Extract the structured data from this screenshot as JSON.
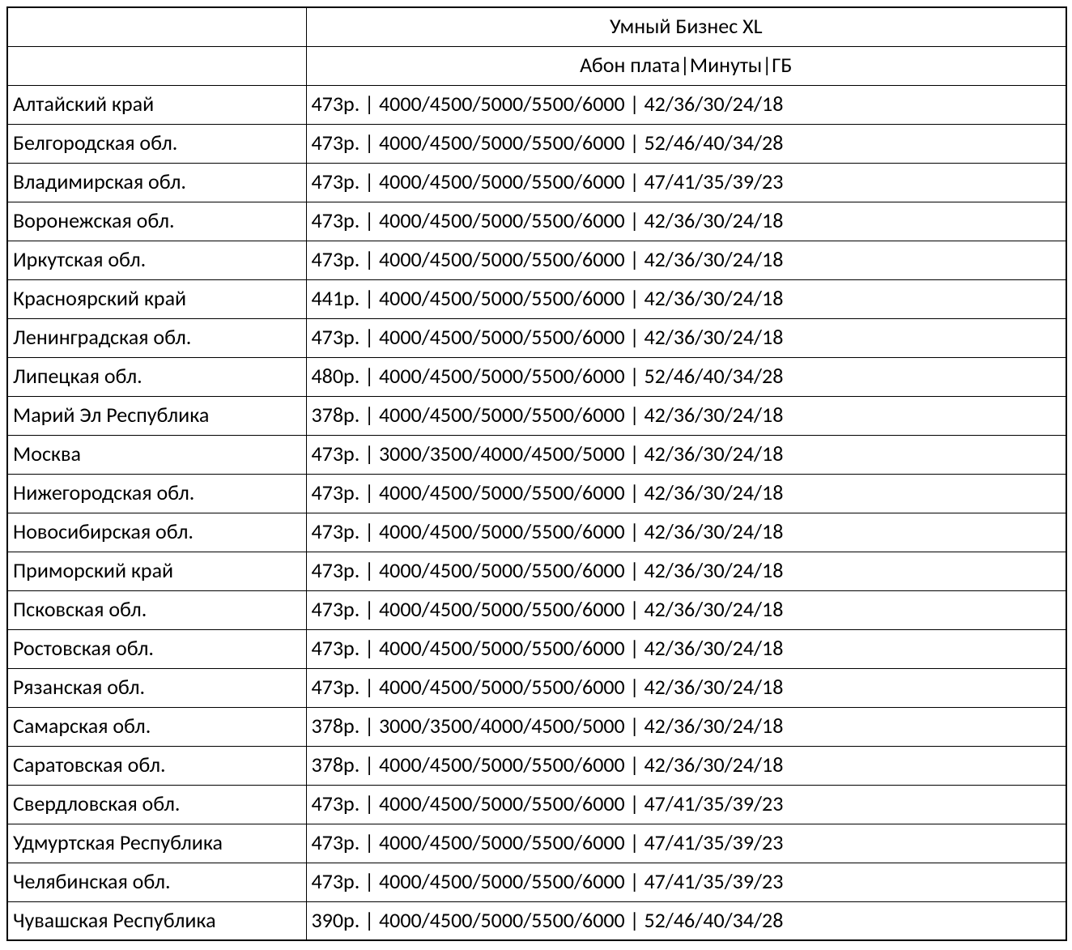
{
  "header": {
    "title": "Умный Бизнес XL",
    "subtitle": "Абон плата|Минуты|ГБ"
  },
  "rows": [
    {
      "region": "Алтайский край",
      "price": "473р.",
      "minutes": "4000/4500/5000/5500/6000",
      "gb": "42/36/30/24/18"
    },
    {
      "region": "Белгородская обл.",
      "price": "473р.",
      "minutes": "4000/4500/5000/5500/6000",
      "gb": "52/46/40/34/28"
    },
    {
      "region": "Владимирская обл.",
      "price": "473р.",
      "minutes": "4000/4500/5000/5500/6000",
      "gb": "47/41/35/39/23"
    },
    {
      "region": "Воронежская обл.",
      "price": "473р.",
      "minutes": "4000/4500/5000/5500/6000",
      "gb": "42/36/30/24/18"
    },
    {
      "region": "Иркутская обл.",
      "price": "473р.",
      "minutes": "4000/4500/5000/5500/6000",
      "gb": "42/36/30/24/18"
    },
    {
      "region": "Красноярский край",
      "price": "441р.",
      "minutes": "4000/4500/5000/5500/6000",
      "gb": "42/36/30/24/18"
    },
    {
      "region": "Ленинградская обл.",
      "price": "473р.",
      "minutes": "4000/4500/5000/5500/6000",
      "gb": "42/36/30/24/18"
    },
    {
      "region": "Липецкая обл.",
      "price": "480р.",
      "minutes": "4000/4500/5000/5500/6000",
      "gb": "52/46/40/34/28"
    },
    {
      "region": "Марий Эл Республика",
      "price": "378р.",
      "minutes": "4000/4500/5000/5500/6000",
      "gb": "42/36/30/24/18"
    },
    {
      "region": "Москва",
      "price": "473р.",
      "minutes": "3000/3500/4000/4500/5000",
      "gb": "42/36/30/24/18"
    },
    {
      "region": "Нижегородская обл.",
      "price": "473р.",
      "minutes": "4000/4500/5000/5500/6000",
      "gb": "42/36/30/24/18"
    },
    {
      "region": "Новосибирская обл.",
      "price": "473р.",
      "minutes": "4000/4500/5000/5500/6000",
      "gb": "42/36/30/24/18"
    },
    {
      "region": "Приморский край",
      "price": "473р.",
      "minutes": "4000/4500/5000/5500/6000",
      "gb": "42/36/30/24/18"
    },
    {
      "region": "Псковская обл.",
      "price": "473р.",
      "minutes": "4000/4500/5000/5500/6000",
      "gb": "42/36/30/24/18"
    },
    {
      "region": "Ростовская обл.",
      "price": "473р.",
      "minutes": "4000/4500/5000/5500/6000",
      "gb": "42/36/30/24/18"
    },
    {
      "region": "Рязанская обл.",
      "price": "473р.",
      "minutes": "4000/4500/5000/5500/6000",
      "gb": "42/36/30/24/18"
    },
    {
      "region": "Самарская обл.",
      "price": "378р.",
      "minutes": "3000/3500/4000/4500/5000",
      "gb": "42/36/30/24/18"
    },
    {
      "region": "Саратовская обл.",
      "price": "378р.",
      "minutes": "4000/4500/5000/5500/6000",
      "gb": "42/36/30/24/18"
    },
    {
      "region": "Свердловская обл.",
      "price": "473р.",
      "minutes": "4000/4500/5000/5500/6000",
      "gb": "47/41/35/39/23"
    },
    {
      "region": "Удмуртская Республика",
      "price": "473р.",
      "minutes": "4000/4500/5000/5500/6000",
      "gb": "47/41/35/39/23"
    },
    {
      "region": "Челябинская обл.",
      "price": "473р.",
      "minutes": "4000/4500/5000/5500/6000",
      "gb": "47/41/35/39/23"
    },
    {
      "region": "Чувашская Республика",
      "price": "390р.",
      "minutes": "4000/4500/5000/5500/6000",
      "gb": "52/46/40/34/28"
    }
  ]
}
